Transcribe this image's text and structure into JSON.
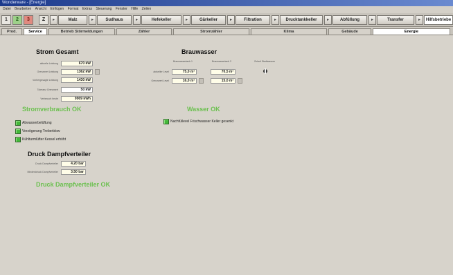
{
  "window": {
    "title": "Wonderware - [Energie]"
  },
  "menu": [
    "Datei",
    "Bearbeiten",
    "Ansicht",
    "Einfügen",
    "Format",
    "Extras",
    "Steuerung",
    "Fenster",
    "Hilfe",
    "Zeilen"
  ],
  "toolbar": {
    "icons": [
      "1",
      "2",
      "3",
      "Z"
    ],
    "buttons": [
      "Malz",
      "Sudhaus",
      "Hefekeller",
      "Gärkeller",
      "Filtration",
      "Drucktankkeller",
      "Abfüllung",
      "Transfer",
      "Hilfsbetriebe"
    ]
  },
  "tabs": [
    "Prod.",
    "Service",
    "Betrieb Störmeldungen",
    "Zähler",
    "Stromzähler",
    "Klima",
    "Gebäude",
    "Energie"
  ],
  "strom": {
    "title": "Strom Gesamt",
    "rows": [
      {
        "label": "aktuelle Leistung",
        "value": "670 kW"
      },
      {
        "label": "Grenzwert Leistung",
        "value": "1362 kW"
      },
      {
        "label": "Vorhergesagte Leistung",
        "value": "1430 kW"
      },
      {
        "label": "Toleranz Grenzwert",
        "value": "50 kW"
      },
      {
        "label": "Verbrauch heute",
        "value": "9909 kWh"
      }
    ],
    "status": "Stromverbrauch OK"
  },
  "indicators": [
    {
      "label": "Abwasserbelüftung"
    },
    {
      "label": "Verzögerung Treberblow"
    },
    {
      "label": "Kühlturmlüfter Kessel erhöht"
    }
  ],
  "dampf": {
    "title": "Druck Dampfverteiler",
    "rows": [
      {
        "label": "Druck Dampfverteiler",
        "value": "4.20 bar"
      },
      {
        "label": "Mindestdruck Dampfverteiler",
        "value": "3.50 bar"
      }
    ],
    "status": "Druck Dampfverteiler OK"
  },
  "brauwasser": {
    "title": "Brauwasser",
    "col1": "Brauwassertank 1",
    "col2": "Brauwassertank 2",
    "col3": "Zulauf Stadtwasser",
    "row1_label": "aktueller Level",
    "row2_label": "Grenzwert Level",
    "t1_level": "75,0 m³",
    "t1_limit": "16,0 m³",
    "t2_level": "70,5 m³",
    "t2_limit": "15,0 m³",
    "status": "Wasser OK",
    "indicator": "Nachfüllevel Frischwasser Keller gesenkt"
  }
}
